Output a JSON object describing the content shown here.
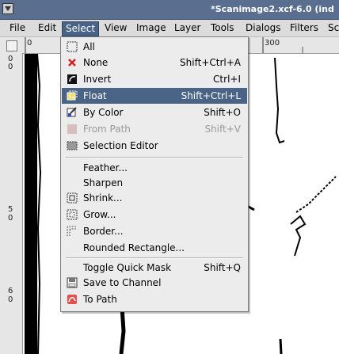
{
  "window": {
    "title": "*Scanimage2.xcf-6.0 (ind"
  },
  "menubar": [
    {
      "label": "File",
      "active": false
    },
    {
      "label": "Edit",
      "active": false
    },
    {
      "label": "Select",
      "active": true
    },
    {
      "label": "View",
      "active": false
    },
    {
      "label": "Image",
      "active": false
    },
    {
      "label": "Layer",
      "active": false
    },
    {
      "label": "Tools",
      "active": false
    },
    {
      "label": "Dialogs",
      "active": false
    },
    {
      "label": "Filters",
      "active": false
    },
    {
      "label": "Sc",
      "active": false
    }
  ],
  "ruler": {
    "top": [
      "0",
      "300"
    ],
    "left": [
      "0",
      "0",
      "5",
      "0",
      "6",
      "0"
    ]
  },
  "select_menu": [
    {
      "label": "All",
      "shortcut": "",
      "icon": "select-all-icon",
      "selected": false,
      "disabled": false
    },
    {
      "label": "None",
      "shortcut": "Shift+Ctrl+A",
      "icon": "select-none-icon",
      "selected": false,
      "disabled": false
    },
    {
      "label": "Invert",
      "shortcut": "Ctrl+I",
      "icon": "invert-icon",
      "selected": false,
      "disabled": false
    },
    {
      "label": "Float",
      "shortcut": "Shift+Ctrl+L",
      "icon": "float-icon",
      "selected": true,
      "disabled": false
    },
    {
      "label": "By Color",
      "shortcut": "Shift+O",
      "icon": "by-color-icon",
      "selected": false,
      "disabled": false
    },
    {
      "label": "From Path",
      "shortcut": "Shift+V",
      "icon": "from-path-icon",
      "selected": false,
      "disabled": true
    },
    {
      "label": "Selection Editor",
      "shortcut": "",
      "icon": "selection-editor-icon",
      "selected": false,
      "disabled": false
    },
    {
      "label": "Feather...",
      "shortcut": "",
      "icon": "",
      "selected": false,
      "disabled": false
    },
    {
      "label": "Sharpen",
      "shortcut": "",
      "icon": "",
      "selected": false,
      "disabled": false
    },
    {
      "label": "Shrink...",
      "shortcut": "",
      "icon": "shrink-icon",
      "selected": false,
      "disabled": false
    },
    {
      "label": "Grow...",
      "shortcut": "",
      "icon": "grow-icon",
      "selected": false,
      "disabled": false
    },
    {
      "label": "Border...",
      "shortcut": "",
      "icon": "border-icon",
      "selected": false,
      "disabled": false
    },
    {
      "label": "Rounded Rectangle...",
      "shortcut": "",
      "icon": "",
      "selected": false,
      "disabled": false
    },
    {
      "label": "Toggle Quick Mask",
      "shortcut": "Shift+Q",
      "icon": "",
      "selected": false,
      "disabled": false
    },
    {
      "label": "Save to Channel",
      "shortcut": "",
      "icon": "save-channel-icon",
      "selected": false,
      "disabled": false
    },
    {
      "label": "To Path",
      "shortcut": "",
      "icon": "to-path-icon",
      "selected": false,
      "disabled": false
    }
  ],
  "colors": {
    "titlebar": "#5a6f8f",
    "highlight": "#4a6488",
    "menu_bg": "#ececec"
  }
}
